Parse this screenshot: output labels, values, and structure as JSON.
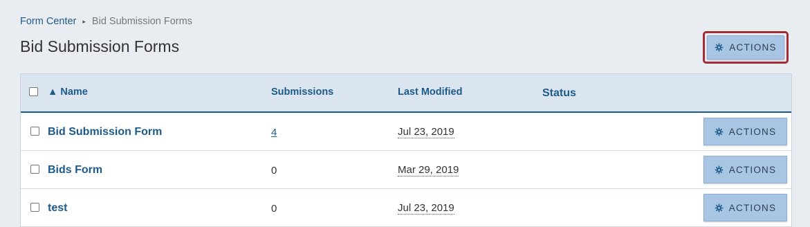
{
  "breadcrumb": {
    "parent": "Form Center",
    "separator": "▸",
    "current": "Bid Submission Forms"
  },
  "page_title": "Bid Submission Forms",
  "actions_label": "ACTIONS",
  "table": {
    "columns": {
      "name": "▲ Name",
      "submissions": "Submissions",
      "last_modified": "Last Modified",
      "status": "Status"
    },
    "rows": [
      {
        "name": "Bid Submission Form",
        "submissions": "4",
        "last_modified": "Jul 23, 2019",
        "status": ""
      },
      {
        "name": "Bids Form",
        "submissions": "0",
        "last_modified": "Mar 29, 2019",
        "status": ""
      },
      {
        "name": "test",
        "submissions": "0",
        "last_modified": "Jul 23, 2019",
        "status": ""
      }
    ]
  },
  "colors": {
    "accent": "#1c5a8a",
    "button_bg": "#a9c5e4",
    "highlight_outline": "#a32b34"
  },
  "icons": {
    "actions": "gear-icon"
  }
}
